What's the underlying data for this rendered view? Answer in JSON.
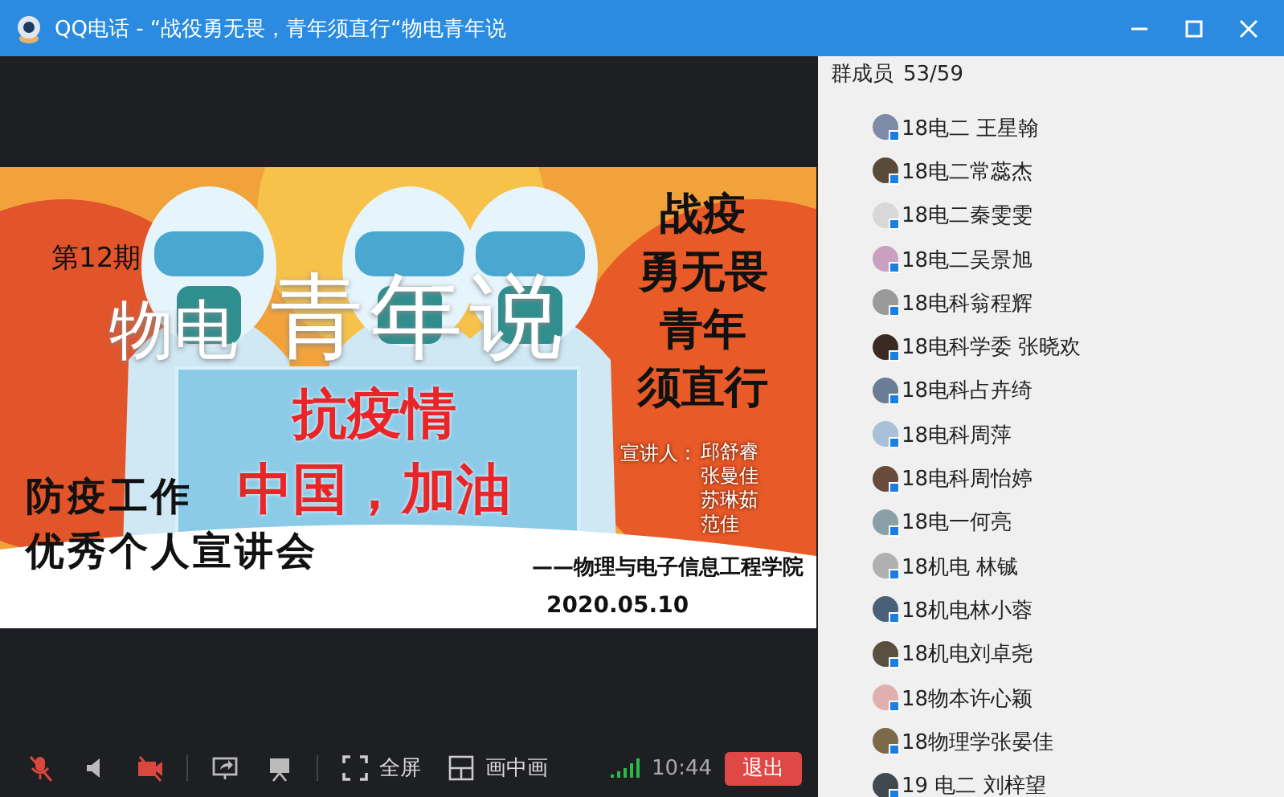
{
  "window": {
    "title": "QQ电话 - “战役勇无畏，青年须直行“物电青年说"
  },
  "slide": {
    "issue": "第12期",
    "title_small": "物电",
    "title_large": "青年说",
    "slogan_lines": [
      "战疫",
      "勇无畏",
      "青年",
      "须直行"
    ],
    "board_lines": [
      "抗疫情",
      "中国，加油"
    ],
    "event_lines": [
      "防疫工作",
      "优秀个人宣讲会"
    ],
    "speakers_label": "宣讲人：",
    "speakers": [
      "邱舒睿",
      "张曼佳",
      "苏琳茹",
      "范佳"
    ],
    "organizer": "——物理与电子信息工程学院",
    "date": "2020.05.10"
  },
  "toolbar": {
    "buttons": [
      {
        "kind": "mic",
        "off": true
      },
      {
        "kind": "speaker",
        "off": false
      },
      {
        "kind": "camera",
        "off": true
      },
      {
        "kind": "share",
        "off": false
      },
      {
        "kind": "present",
        "off": false
      },
      {
        "kind": "fullscreen",
        "label": "全屏"
      },
      {
        "kind": "pip",
        "label": "画中画"
      }
    ],
    "time": "10:44",
    "exit_label": "退出"
  },
  "members": {
    "title": "群成员",
    "count": "53/59",
    "items": [
      {
        "name": "18电二 王星翰"
      },
      {
        "name": "18电二常蕊杰"
      },
      {
        "name": "18电二秦雯雯"
      },
      {
        "name": "18电二吴景旭"
      },
      {
        "name": "18电科翁程辉"
      },
      {
        "name": "18电科学委 张晓欢"
      },
      {
        "name": "18电科占卉绮"
      },
      {
        "name": "18电科周萍"
      },
      {
        "name": "18电科周怡婷"
      },
      {
        "name": "18电一何亮"
      },
      {
        "name": "18机电 林铖"
      },
      {
        "name": "18机电林小蓉"
      },
      {
        "name": "18机电刘卓尧"
      },
      {
        "name": "18物本许心颖"
      },
      {
        "name": "18物理学张晏佳"
      },
      {
        "name": "19 电二 刘梓望"
      }
    ]
  }
}
